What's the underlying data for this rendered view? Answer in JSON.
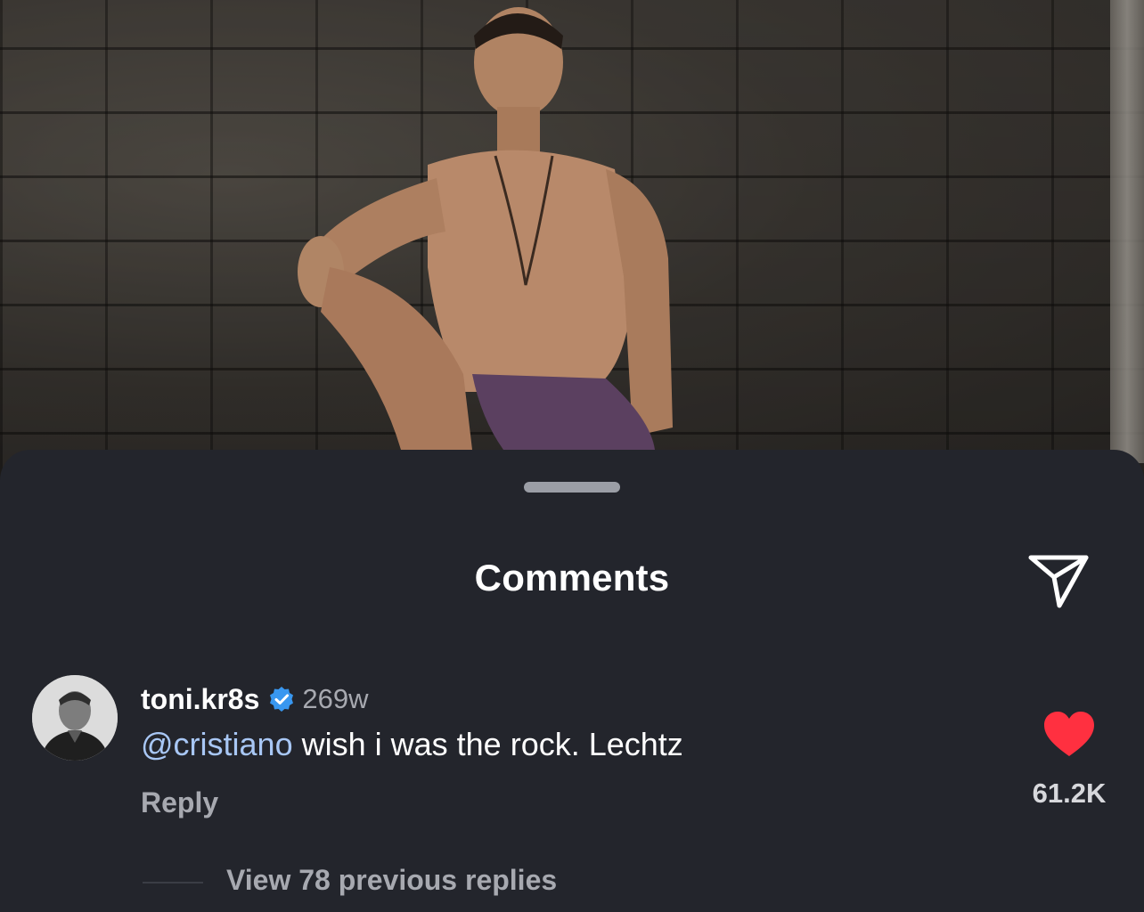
{
  "sheet": {
    "title": "Comments"
  },
  "comment": {
    "username": "toni.kr8s",
    "verified": true,
    "timestamp": "269w",
    "mention": "@cristiano",
    "text": " wish i was the rock. Lechtz",
    "reply_label": "Reply",
    "like_count": "61.2K",
    "liked": true
  },
  "replies": {
    "view_label": "View 78 previous replies"
  },
  "colors": {
    "sheet_bg": "#23252c",
    "mention": "#a8c7f5",
    "verified": "#3897f0",
    "like": "#ff3040",
    "secondary_text": "#a7a9b0"
  },
  "icons": {
    "share": "paper-plane-icon",
    "verified": "verified-badge-icon",
    "like": "heart-icon"
  }
}
